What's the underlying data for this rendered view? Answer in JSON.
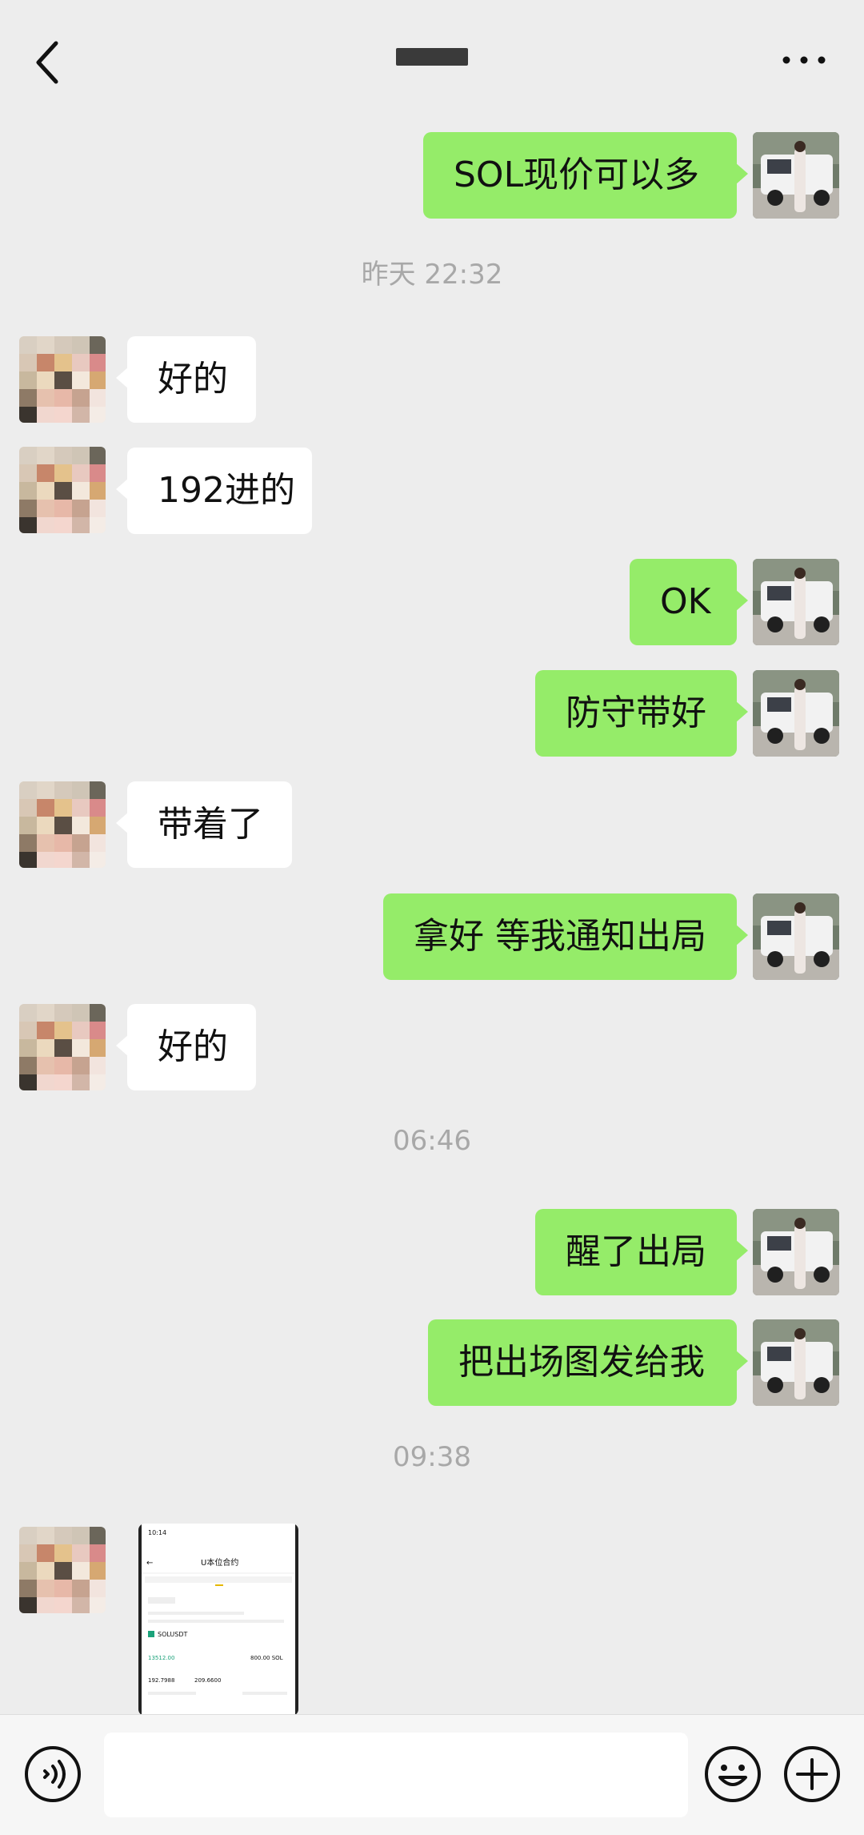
{
  "header": {
    "back_icon": "chevron-left-icon",
    "more_icon": "more-dots-icon"
  },
  "messages": [
    {
      "side": "out",
      "text": "SOL现价可以多"
    },
    {
      "side": "time",
      "text": "昨天 22:32"
    },
    {
      "side": "in",
      "text": "好的"
    },
    {
      "side": "in",
      "text": "192进的"
    },
    {
      "side": "out",
      "text": "OK"
    },
    {
      "side": "out",
      "text": "防守带好"
    },
    {
      "side": "in",
      "text": "带着了"
    },
    {
      "side": "out",
      "text": "拿好 等我通知出局"
    },
    {
      "side": "in",
      "text": "好的"
    },
    {
      "side": "time",
      "text": "06:46"
    },
    {
      "side": "out",
      "text": "醒了出局"
    },
    {
      "side": "out",
      "text": "把出场图发给我"
    },
    {
      "side": "time",
      "text": "09:38"
    }
  ],
  "image_message": {
    "status_time": "10:14",
    "title": "U本位合约",
    "symbol": "SOLUSDT",
    "value1": "13512.00",
    "value2": "800.00 SOL",
    "value3": "192.7988",
    "value4": "209.6600"
  },
  "bottombar": {
    "voice_icon": "voice-icon",
    "emoji_icon": "emoji-icon",
    "plus_icon": "plus-icon"
  },
  "colors": {
    "out_bubble": "#95EC69",
    "in_bubble": "#FFFFFF",
    "background": "#EDEDED"
  }
}
